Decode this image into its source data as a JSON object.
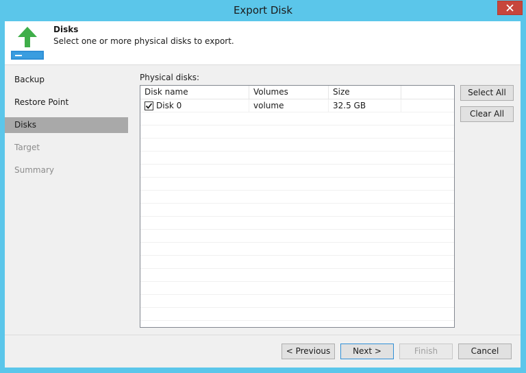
{
  "window": {
    "title": "Export Disk",
    "close_icon": "close-icon"
  },
  "header": {
    "title": "Disks",
    "description": "Select one or more physical disks to export.",
    "icon": "export-arrow-icon"
  },
  "sidebar": {
    "items": [
      {
        "label": "Backup",
        "state": "normal"
      },
      {
        "label": "Restore Point",
        "state": "normal"
      },
      {
        "label": "Disks",
        "state": "active"
      },
      {
        "label": "Target",
        "state": "disabled"
      },
      {
        "label": "Summary",
        "state": "disabled"
      }
    ]
  },
  "main": {
    "physical_disks_label": "Physical disks:",
    "table": {
      "columns": [
        "Disk name",
        "Volumes",
        "Size"
      ],
      "rows": [
        {
          "checked": true,
          "disk_name": "Disk 0",
          "volumes": "volume",
          "size": "32.5 GB"
        }
      ]
    },
    "select_all_label": "Select All",
    "clear_all_label": "Clear All"
  },
  "footer": {
    "previous_label": "< Previous",
    "next_label": "Next >",
    "finish_label": "Finish",
    "cancel_label": "Cancel"
  },
  "colors": {
    "title_bar": "#5bc6ea",
    "close_button": "#c7463c",
    "arrow_green": "#3fae49",
    "drive_blue": "#2f8fd6",
    "active_nav": "#a9a9a9"
  }
}
